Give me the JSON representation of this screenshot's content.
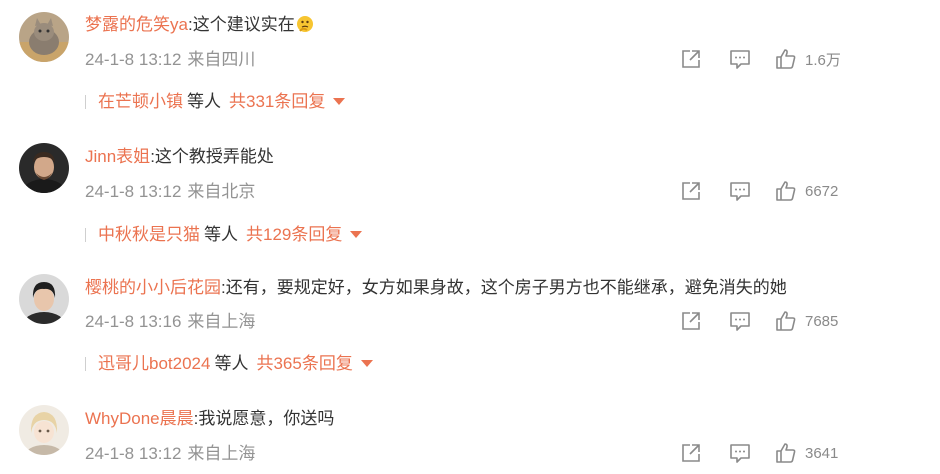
{
  "colors": {
    "accent": "#eb7350",
    "meta": "#939393",
    "text": "#333333"
  },
  "comments": [
    {
      "username": "梦露的危笑ya",
      "text": ":这个建议实在",
      "emoji": "thinking-emoji",
      "time": "24-1-8 13:12",
      "location": "来自四川",
      "likes": "1.6万",
      "reply_user": "在芒顿小镇",
      "reply_etc": "等人",
      "reply_total": "共331条回复"
    },
    {
      "username": "Jinn表姐",
      "text": ":这个教授弄能处",
      "time": "24-1-8 13:12",
      "location": "来自北京",
      "likes": "6672",
      "reply_user": "中秋秋是只猫",
      "reply_etc": "等人",
      "reply_total": "共129条回复"
    },
    {
      "username": "樱桃的小小后花园",
      "text": ":还有，要规定好，女方如果身故，这个房子男方也不能继承，避免消失的她",
      "time": "24-1-8 13:16",
      "location": "来自上海",
      "likes": "7685",
      "reply_user": "迅哥儿bot2024",
      "reply_etc": "等人",
      "reply_total": "共365条回复"
    },
    {
      "username": "WhyDone晨晨",
      "text": ":我说愿意，你送吗",
      "time": "24-1-8 13:12",
      "location": "来自上海",
      "likes": "3641"
    }
  ]
}
